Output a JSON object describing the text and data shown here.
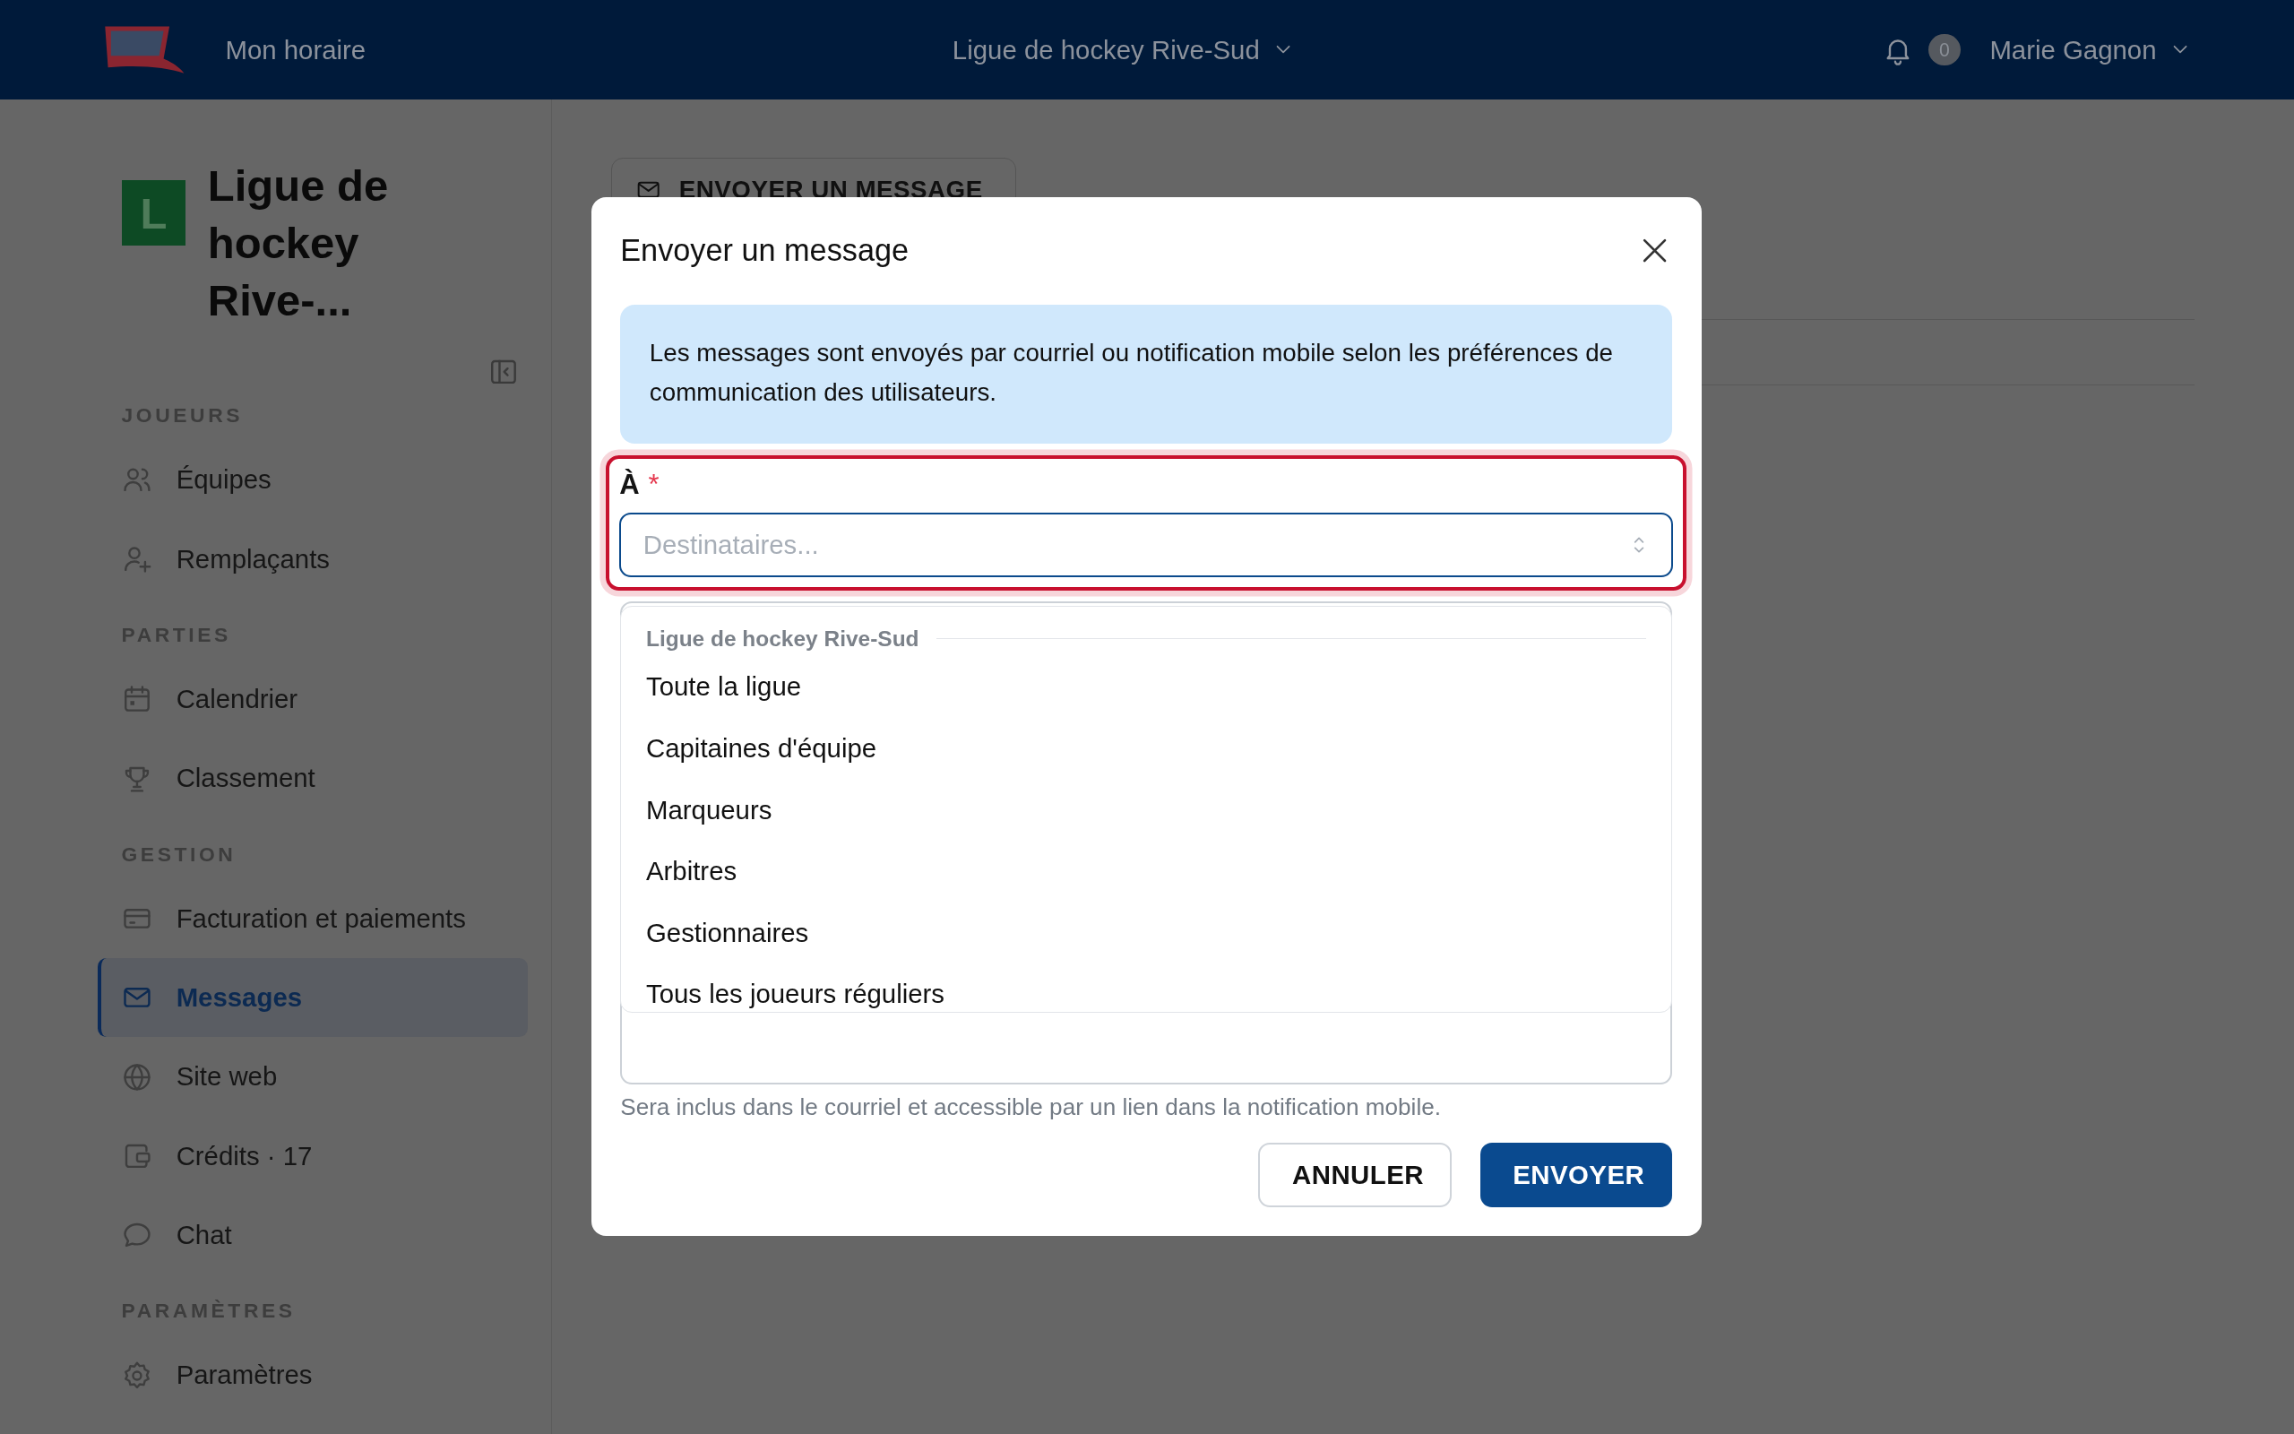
{
  "top_nav": {
    "link": "Mon horaire",
    "league_selector": "Ligue de hockey Rive-Sud",
    "notification_count": "0",
    "user": "Marie Gagnon"
  },
  "sidebar": {
    "org_initial": "L",
    "org_name": "Ligue de hockey Rive-...",
    "sections": [
      {
        "title": "JOUEURS",
        "items": [
          {
            "label": "Équipes",
            "selected": false
          },
          {
            "label": "Remplaçants",
            "selected": false
          }
        ]
      },
      {
        "title": "PARTIES",
        "items": [
          {
            "label": "Calendrier",
            "selected": false
          },
          {
            "label": "Classement",
            "selected": false
          }
        ]
      },
      {
        "title": "GESTION",
        "items": [
          {
            "label": "Facturation et paiements",
            "selected": false
          },
          {
            "label": "Messages",
            "selected": true
          },
          {
            "label": "Site web",
            "selected": false
          },
          {
            "label": "Crédits · 17",
            "selected": false
          },
          {
            "label": "Chat",
            "selected": false
          }
        ]
      },
      {
        "title": "PARAMÈTRES",
        "items": [
          {
            "label": "Paramètres",
            "selected": false
          }
        ]
      }
    ]
  },
  "main": {
    "action_button": "ENVOYER UN MESSAGE"
  },
  "dialog": {
    "title": "Envoyer un message",
    "info": "Les messages sont envoyés par courriel ou notification mobile selon les préférences de communication des utilisateurs.",
    "recipients": {
      "label": "À",
      "required_mark": "*",
      "placeholder": "Destinataires...",
      "focused": true
    },
    "dropdown": {
      "group": "Ligue de hockey Rive-Sud",
      "options": [
        {
          "label": "Toute la ligue",
          "selected": false
        },
        {
          "label": "Capitaines d'équipe",
          "selected": false
        },
        {
          "label": "Marqueurs",
          "selected": false
        },
        {
          "label": "Arbitres",
          "selected": false
        },
        {
          "label": "Gestionnaires",
          "selected": false
        },
        {
          "label": "Tous les joueurs réguliers",
          "selected": false
        }
      ]
    },
    "hint": "Sera inclus dans le courriel et accessible par un lien dans la notification mobile.",
    "buttons": [
      {
        "label": "ANNULER",
        "kind": "secondary"
      },
      {
        "label": "ENVOYER",
        "kind": "primary"
      }
    ]
  }
}
